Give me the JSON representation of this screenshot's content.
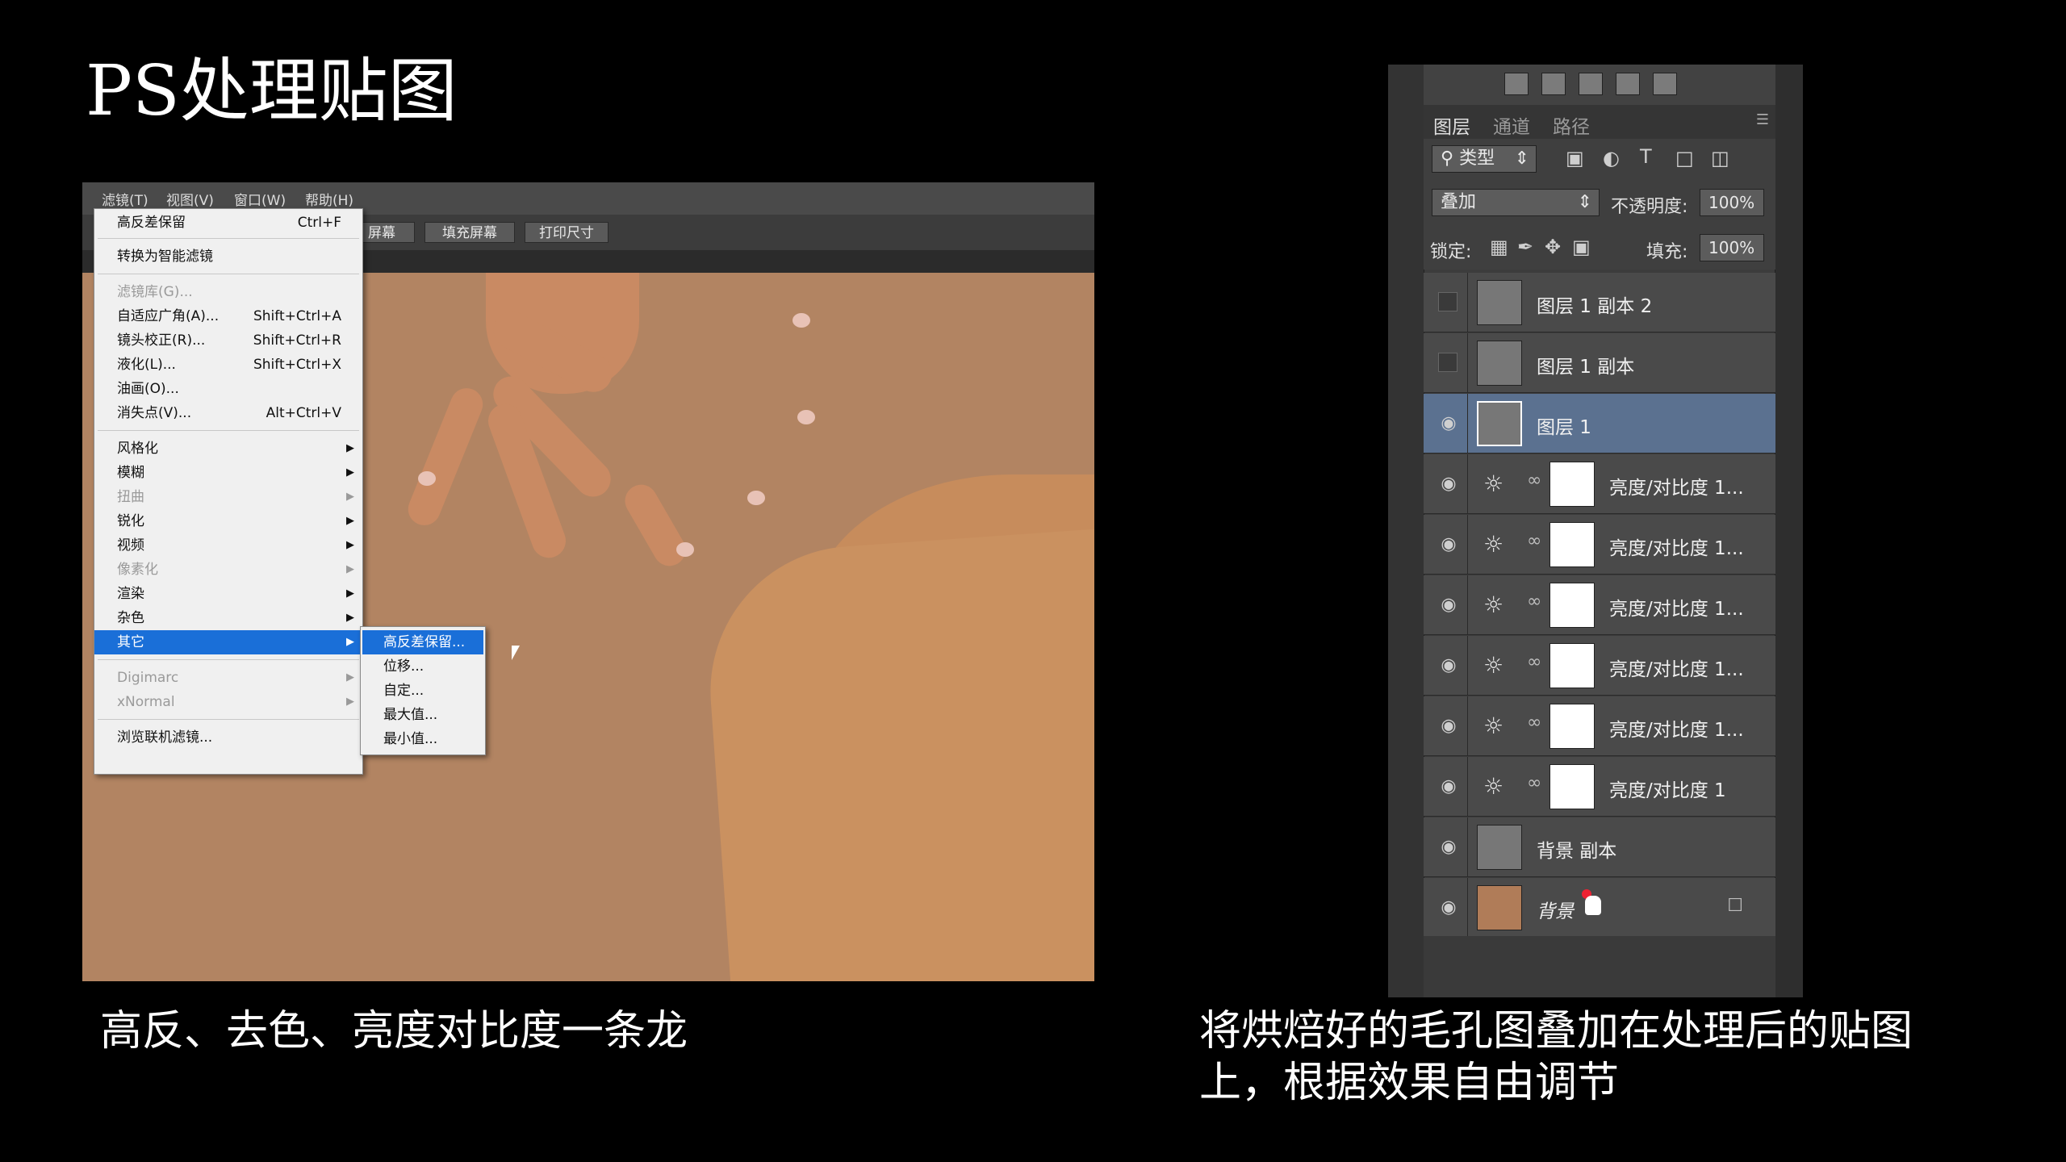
{
  "slide": {
    "title": "PS处理贴图",
    "caption_left": "高反、去色、亮度对比度一条龙",
    "caption_right": "将烘焙好的毛孔图叠加在处理后的贴图上，根据效果自由调节"
  },
  "photoshop_left": {
    "menubar": [
      "滤镜(T)",
      "视图(V)",
      "窗口(W)",
      "帮助(H)"
    ],
    "option_buttons": [
      "屏幕",
      "填充屏幕",
      "打印尺寸"
    ],
    "filter_menu": {
      "last_filter": {
        "label": "高反差保留",
        "shortcut": "Ctrl+F"
      },
      "convert_smart": "转换为智能滤镜",
      "group1": [
        {
          "label": "滤镜库(G)...",
          "shortcut": "",
          "disabled": true
        },
        {
          "label": "自适应广角(A)...",
          "shortcut": "Shift+Ctrl+A"
        },
        {
          "label": "镜头校正(R)...",
          "shortcut": "Shift+Ctrl+R"
        },
        {
          "label": "液化(L)...",
          "shortcut": "Shift+Ctrl+X"
        },
        {
          "label": "油画(O)...",
          "shortcut": ""
        },
        {
          "label": "消失点(V)...",
          "shortcut": "Alt+Ctrl+V"
        }
      ],
      "group2": [
        {
          "label": "风格化",
          "disabled": false
        },
        {
          "label": "模糊",
          "disabled": false
        },
        {
          "label": "扭曲",
          "disabled": true
        },
        {
          "label": "锐化",
          "disabled": false
        },
        {
          "label": "视频",
          "disabled": false
        },
        {
          "label": "像素化",
          "disabled": true
        },
        {
          "label": "渲染",
          "disabled": false
        },
        {
          "label": "杂色",
          "disabled": false
        },
        {
          "label": "其它",
          "disabled": false,
          "active": true
        }
      ],
      "group3": [
        {
          "label": "Digimarc",
          "disabled": true
        },
        {
          "label": "xNormal",
          "disabled": true
        }
      ],
      "browse_online": "浏览联机滤镜..."
    },
    "submenu": [
      "高反差保留...",
      "位移...",
      "自定...",
      "最大值...",
      "最小值..."
    ]
  },
  "layers_panel": {
    "tabs": [
      "图层",
      "通道",
      "路径"
    ],
    "filter_kind": "类型",
    "blend_mode": "叠加",
    "opacity_label": "不透明度:",
    "opacity_value": "100%",
    "lock_label": "锁定:",
    "fill_label": "填充:",
    "fill_value": "100%",
    "layers": [
      {
        "name": "图层 1 副本 2",
        "visible": false,
        "type": "pixel"
      },
      {
        "name": "图层 1 副本",
        "visible": false,
        "type": "pixel"
      },
      {
        "name": "图层 1",
        "visible": true,
        "type": "pixel",
        "selected": true
      },
      {
        "name": "亮度/对比度 1...",
        "visible": true,
        "type": "adjustment"
      },
      {
        "name": "亮度/对比度 1...",
        "visible": true,
        "type": "adjustment"
      },
      {
        "name": "亮度/对比度 1...",
        "visible": true,
        "type": "adjustment"
      },
      {
        "name": "亮度/对比度 1...",
        "visible": true,
        "type": "adjustment"
      },
      {
        "name": "亮度/对比度 1...",
        "visible": true,
        "type": "adjustment"
      },
      {
        "name": "亮度/对比度 1",
        "visible": true,
        "type": "adjustment"
      },
      {
        "name": "背景 副本",
        "visible": true,
        "type": "pixel"
      },
      {
        "name": "背景",
        "visible": true,
        "type": "background",
        "locked": true
      }
    ]
  },
  "colors": {
    "canvas_skin": "#b28462",
    "menu_highlight": "#1a6fd8",
    "layer_selected": "#5b7190"
  }
}
